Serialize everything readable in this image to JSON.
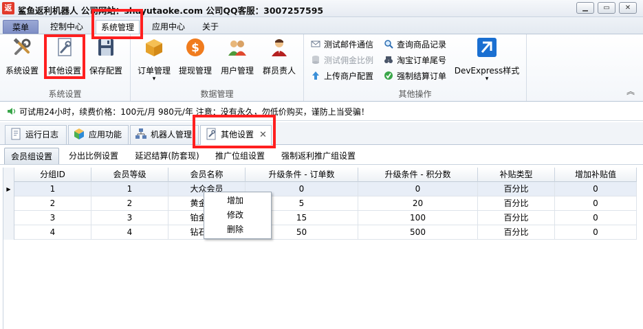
{
  "window": {
    "icon_text": "返",
    "title": "鲨鱼返利机器人 公司网站：shayutaoke.com 公司QQ客服：3007257595",
    "buttons": {
      "minimize": "▭",
      "maximize": "▭",
      "close": "✕"
    }
  },
  "menu": {
    "items": [
      "菜单",
      "控制中心",
      "系统管理",
      "应用中心",
      "关于"
    ],
    "active": "系统管理"
  },
  "ribbon": {
    "groups": [
      {
        "label": "系统设置",
        "buttons": [
          "系统设置",
          "其他设置",
          "保存配置"
        ]
      },
      {
        "label": "数据管理",
        "buttons": [
          "订单管理",
          "提现管理",
          "用户管理",
          "群员责人"
        ]
      },
      {
        "label": "其他操作",
        "small_buttons": [
          "测试邮件通信",
          "测试佣金比例",
          "上传商户配置",
          "查询商品记录",
          "淘宝订单尾号",
          "强制结算订单"
        ],
        "big_button": "DevExpress样式"
      }
    ],
    "dropdown_arrow": "▾",
    "collapse_glyph": "︽"
  },
  "notice": {
    "icon": "speaker-icon",
    "text": "可试用24小时，续费价格：100元/月  980元/年  注意：没有永久，勿低价购买，谨防上当受骗！"
  },
  "doc_tabs": [
    {
      "label": "运行日志",
      "icon": "log-icon"
    },
    {
      "label": "应用功能",
      "icon": "cube-icon"
    },
    {
      "label": "机器人管理",
      "icon": "network-icon"
    },
    {
      "label": "其他设置",
      "icon": "settings-doc-icon",
      "active": true,
      "close": "✕"
    }
  ],
  "sub_tabs": [
    "会员组设置",
    "分出比例设置",
    "延迟结算(防套现)",
    "推广位组设置",
    "强制返利推广组设置"
  ],
  "grid": {
    "columns": [
      "分组ID",
      "会员等级",
      "会员名称",
      "升级条件 - 订单数",
      "升级条件 - 积分数",
      "补贴类型",
      "增加补贴值"
    ],
    "rows": [
      [
        "1",
        "1",
        "大众会员",
        "0",
        "0",
        "百分比",
        "0"
      ],
      [
        "2",
        "2",
        "黄金会员",
        "5",
        "20",
        "百分比",
        "0"
      ],
      [
        "3",
        "3",
        "铂金会员",
        "15",
        "100",
        "百分比",
        "0"
      ],
      [
        "4",
        "4",
        "钻石会员",
        "50",
        "500",
        "百分比",
        "0"
      ]
    ],
    "current_row_indicator": "▶"
  },
  "context_menu": {
    "items": [
      "增加",
      "修改",
      "删除"
    ]
  },
  "colors": {
    "highlight": "#ff1f1f",
    "file_tab": "#8f9dcf",
    "selected_row": "#e8eef7"
  }
}
